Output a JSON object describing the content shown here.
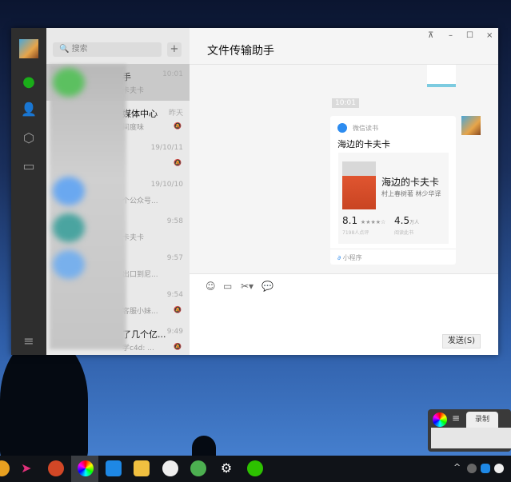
{
  "window": {
    "title": "文件传输助手",
    "controls": {
      "pin": "⊼",
      "minimize": "–",
      "maximize": "☐",
      "close": "×"
    }
  },
  "sidebar": {
    "icons": [
      "chat-icon",
      "contacts-icon",
      "mini-program-icon",
      "folder-icon",
      "menu-icon"
    ]
  },
  "search": {
    "placeholder": "搜索",
    "add": "+"
  },
  "chats": [
    {
      "name": "手",
      "preview": "卡夫卡",
      "time": "10:01",
      "muted": false,
      "selected": true
    },
    {
      "name": "媒体中心",
      "preview": "间度味",
      "time": "昨天",
      "muted": true
    },
    {
      "name": "",
      "preview": "",
      "time": "19/10/11",
      "muted": true
    },
    {
      "name": "",
      "preview": "个公众号...",
      "time": "19/10/10",
      "muted": false
    },
    {
      "name": "",
      "preview": "卡夫卡",
      "time": "9:58",
      "muted": false
    },
    {
      "name": "",
      "preview": "出口到尼...",
      "time": "9:57",
      "muted": false
    },
    {
      "name": "",
      "preview": "客服小妹...",
      "time": "9:54",
      "muted": true
    },
    {
      "name": "了几个亿...",
      "preview": "学c4d: ...",
      "time": "9:49",
      "muted": true
    }
  ],
  "messages": {
    "timestamp": "10:01",
    "card": {
      "app": "微信读书",
      "title": "海边的卡夫卡",
      "book_title": "海边的卡夫卡",
      "author": "村上春树著 林少华译",
      "rating": "8.1",
      "rating_stars": 4,
      "rating_count": "7198人点评",
      "readers": "4.5",
      "readers_unit": "万人",
      "readers_label": "阅读此书",
      "footer": "小程序"
    }
  },
  "input": {
    "send_label": "发送(S)",
    "tools": [
      "emoji-icon",
      "file-icon",
      "screenshot-icon",
      "chat-history-icon"
    ]
  },
  "recorder": {
    "tab": "录制"
  }
}
